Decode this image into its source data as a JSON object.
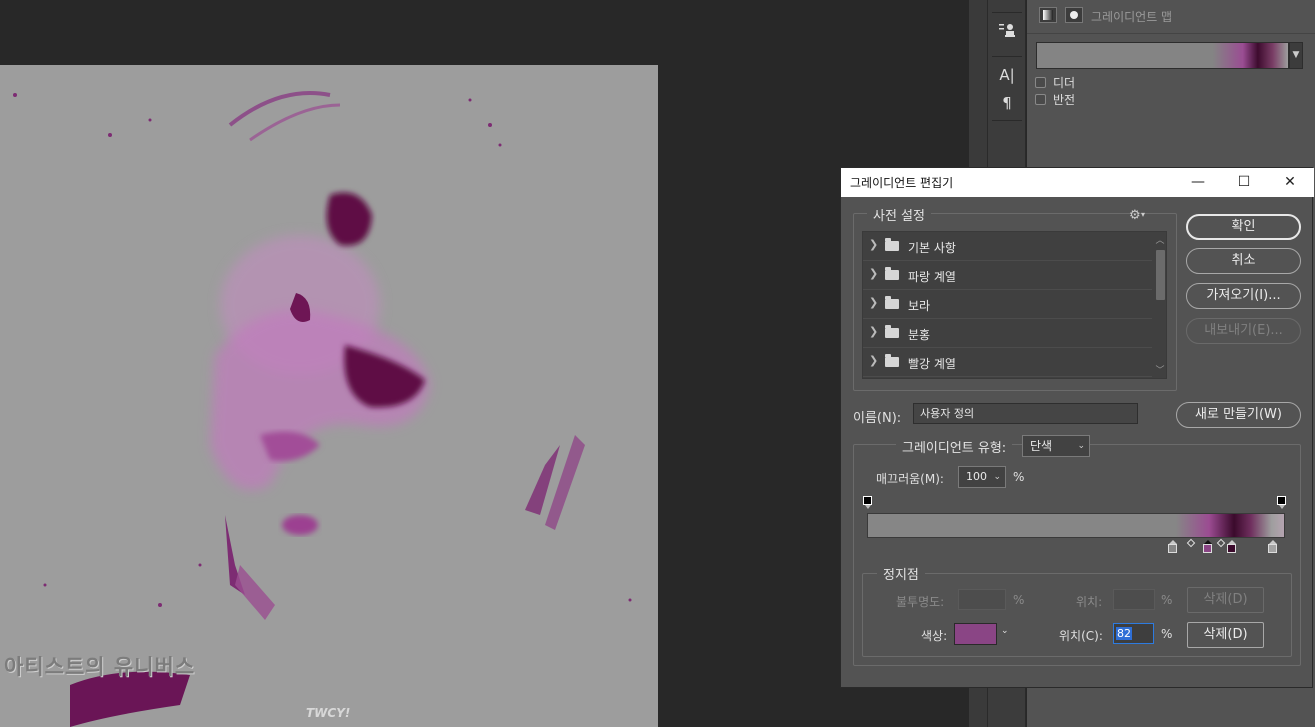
{
  "canvas": {
    "watermark_text": "아티스트의 유니버스",
    "bottom_text": "TWCY!"
  },
  "tools": {
    "icons": [
      "stamp-icon",
      "type-icon",
      "paragraph-icon"
    ],
    "type_glyph": "A|",
    "paragraph_glyph": "¶"
  },
  "properties": {
    "title": "그레이디언트 맵",
    "dither_label": "디더",
    "reverse_label": "반전"
  },
  "dialog": {
    "title": "그레이디언트 편집기",
    "window_controls": {
      "minimize": "—",
      "maximize": "☐",
      "close": "✕"
    },
    "presets": {
      "legend": "사전 설정",
      "gear": "⚙",
      "items": [
        {
          "label": "기본 사항"
        },
        {
          "label": "파랑 계열"
        },
        {
          "label": "보라"
        },
        {
          "label": "분홍"
        },
        {
          "label": "빨강 계열"
        }
      ]
    },
    "buttons": {
      "ok": "확인",
      "cancel": "취소",
      "import": "가져오기(I)...",
      "export": "내보내기(E)...",
      "new": "새로 만들기(W)"
    },
    "name": {
      "label": "이름(N):",
      "value": "사용자 정의"
    },
    "gradient_type": {
      "label": "그레이디언트 유형:",
      "value": "단색"
    },
    "smoothness": {
      "label": "매끄러움(M):",
      "value": "100",
      "unit": "%"
    },
    "stops": {
      "legend": "정지점",
      "opacity_label": "불투명도:",
      "opacity_unit": "%",
      "opacity_location_label": "위치:",
      "opacity_location_unit": "%",
      "opacity_delete": "삭제(D)",
      "color_label": "색상:",
      "color_value": "#8a4585",
      "color_location_label": "위치(C):",
      "color_location_value": "82",
      "color_location_unit": "%",
      "color_delete": "삭제(D)"
    },
    "gradient_colors": [
      "#868686",
      "#9b4c92",
      "#3b0a2c",
      "#6f2f5e",
      "#9e9e9e"
    ]
  }
}
